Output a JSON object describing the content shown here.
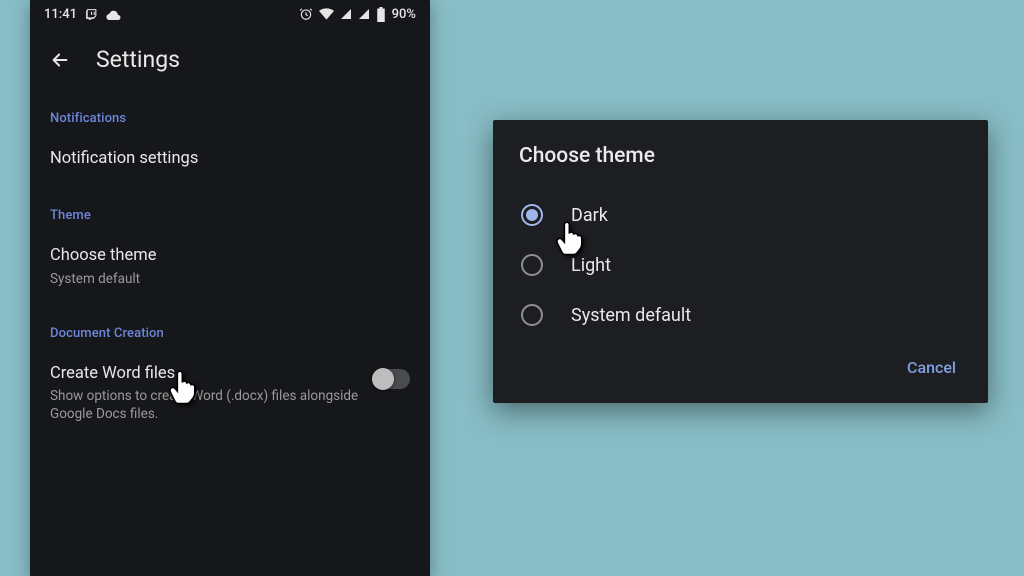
{
  "statusbar": {
    "time": "11:41",
    "battery_text": "90%"
  },
  "header": {
    "title": "Settings"
  },
  "sections": {
    "notifications": {
      "label": "Notifications",
      "item_title": "Notification settings"
    },
    "theme": {
      "label": "Theme",
      "item_title": "Choose theme",
      "item_subtitle": "System default"
    },
    "document_creation": {
      "label": "Document Creation",
      "item_title": "Create Word files",
      "item_subtitle": "Show options to create Word (.docx) files alongside Google Docs files."
    }
  },
  "dialog": {
    "title": "Choose theme",
    "options": {
      "dark": "Dark",
      "light": "Light",
      "system": "System default"
    },
    "cancel": "Cancel"
  }
}
